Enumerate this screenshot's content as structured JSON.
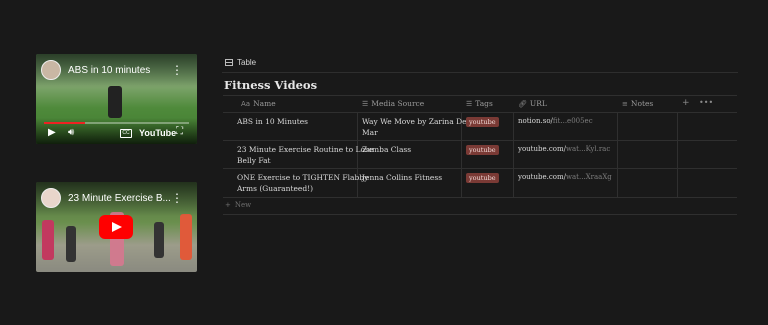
{
  "videos": [
    {
      "title": "ABS in 10 minutes",
      "platform": "YouTube",
      "progress_fraction": 0.28,
      "controls": [
        "play",
        "volume",
        "captions",
        "YouTube",
        "fullscreen"
      ]
    },
    {
      "title": "23 Minute Exercise B...",
      "platform": "YouTube"
    }
  ],
  "view": {
    "tab_label": "Table",
    "tab_icon": "table-icon"
  },
  "database": {
    "title": "Fitness Videos",
    "columns": [
      {
        "label": "Name",
        "icon": "Aa"
      },
      {
        "label": "Media Source",
        "icon": "list-icon"
      },
      {
        "label": "Tags",
        "icon": "list-icon"
      },
      {
        "label": "URL",
        "icon": "link-icon"
      },
      {
        "label": "Notes",
        "icon": "lines-icon"
      }
    ],
    "rows": [
      {
        "name": [
          "ABS in 10 Minutes"
        ],
        "media_source": [
          "Way We Move by Zarina Del",
          "Mar"
        ],
        "tag": "youtube",
        "url_main": "notion.so/",
        "url_faded": "fit...e005ec"
      },
      {
        "name": [
          "23 Minute Exercise Routine to Lose",
          "Belly Fat"
        ],
        "media_source": [
          "Zumba Class"
        ],
        "tag": "youtube",
        "url_main": "youtube.com/",
        "url_faded": "wat...Kyl.rac"
      },
      {
        "name": [
          "ONE Exercise to TIGHTEN Flabby",
          "Arms (Guaranteed!)"
        ],
        "media_source": [
          "Jenna Collins Fitness"
        ],
        "tag": "youtube",
        "url_main": "youtube.com/",
        "url_faded": "wat...XraaXg"
      }
    ],
    "new_label": "New",
    "tag_color": "#7a3a35"
  }
}
